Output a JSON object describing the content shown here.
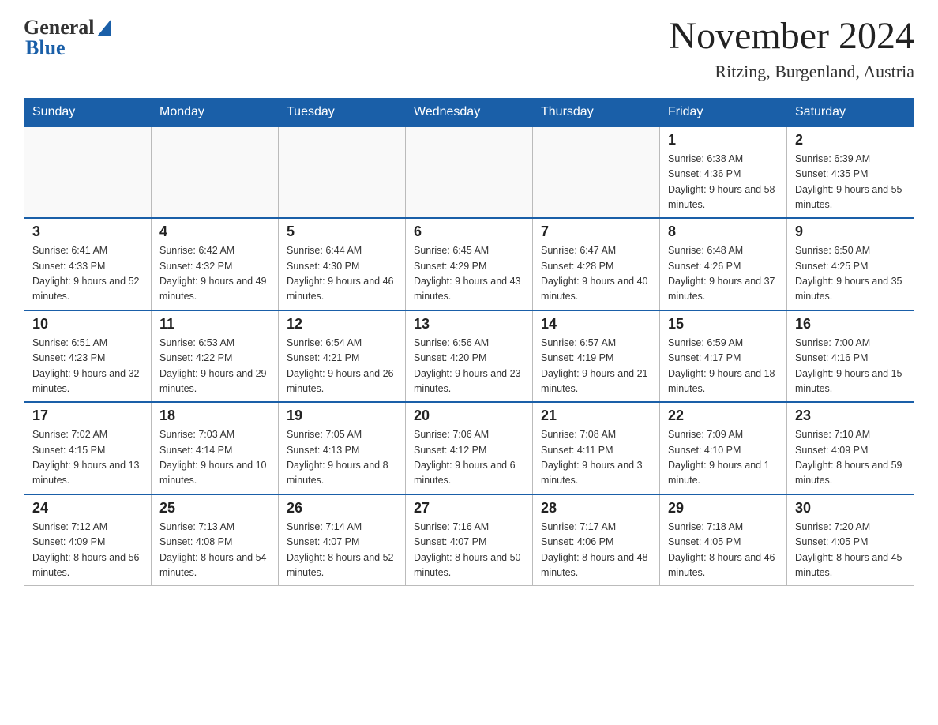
{
  "header": {
    "logo_general": "General",
    "logo_blue": "Blue",
    "title": "November 2024",
    "subtitle": "Ritzing, Burgenland, Austria"
  },
  "days_of_week": [
    "Sunday",
    "Monday",
    "Tuesday",
    "Wednesday",
    "Thursday",
    "Friday",
    "Saturday"
  ],
  "weeks": [
    [
      {
        "day": "",
        "info": ""
      },
      {
        "day": "",
        "info": ""
      },
      {
        "day": "",
        "info": ""
      },
      {
        "day": "",
        "info": ""
      },
      {
        "day": "",
        "info": ""
      },
      {
        "day": "1",
        "info": "Sunrise: 6:38 AM\nSunset: 4:36 PM\nDaylight: 9 hours and 58 minutes."
      },
      {
        "day": "2",
        "info": "Sunrise: 6:39 AM\nSunset: 4:35 PM\nDaylight: 9 hours and 55 minutes."
      }
    ],
    [
      {
        "day": "3",
        "info": "Sunrise: 6:41 AM\nSunset: 4:33 PM\nDaylight: 9 hours and 52 minutes."
      },
      {
        "day": "4",
        "info": "Sunrise: 6:42 AM\nSunset: 4:32 PM\nDaylight: 9 hours and 49 minutes."
      },
      {
        "day": "5",
        "info": "Sunrise: 6:44 AM\nSunset: 4:30 PM\nDaylight: 9 hours and 46 minutes."
      },
      {
        "day": "6",
        "info": "Sunrise: 6:45 AM\nSunset: 4:29 PM\nDaylight: 9 hours and 43 minutes."
      },
      {
        "day": "7",
        "info": "Sunrise: 6:47 AM\nSunset: 4:28 PM\nDaylight: 9 hours and 40 minutes."
      },
      {
        "day": "8",
        "info": "Sunrise: 6:48 AM\nSunset: 4:26 PM\nDaylight: 9 hours and 37 minutes."
      },
      {
        "day": "9",
        "info": "Sunrise: 6:50 AM\nSunset: 4:25 PM\nDaylight: 9 hours and 35 minutes."
      }
    ],
    [
      {
        "day": "10",
        "info": "Sunrise: 6:51 AM\nSunset: 4:23 PM\nDaylight: 9 hours and 32 minutes."
      },
      {
        "day": "11",
        "info": "Sunrise: 6:53 AM\nSunset: 4:22 PM\nDaylight: 9 hours and 29 minutes."
      },
      {
        "day": "12",
        "info": "Sunrise: 6:54 AM\nSunset: 4:21 PM\nDaylight: 9 hours and 26 minutes."
      },
      {
        "day": "13",
        "info": "Sunrise: 6:56 AM\nSunset: 4:20 PM\nDaylight: 9 hours and 23 minutes."
      },
      {
        "day": "14",
        "info": "Sunrise: 6:57 AM\nSunset: 4:19 PM\nDaylight: 9 hours and 21 minutes."
      },
      {
        "day": "15",
        "info": "Sunrise: 6:59 AM\nSunset: 4:17 PM\nDaylight: 9 hours and 18 minutes."
      },
      {
        "day": "16",
        "info": "Sunrise: 7:00 AM\nSunset: 4:16 PM\nDaylight: 9 hours and 15 minutes."
      }
    ],
    [
      {
        "day": "17",
        "info": "Sunrise: 7:02 AM\nSunset: 4:15 PM\nDaylight: 9 hours and 13 minutes."
      },
      {
        "day": "18",
        "info": "Sunrise: 7:03 AM\nSunset: 4:14 PM\nDaylight: 9 hours and 10 minutes."
      },
      {
        "day": "19",
        "info": "Sunrise: 7:05 AM\nSunset: 4:13 PM\nDaylight: 9 hours and 8 minutes."
      },
      {
        "day": "20",
        "info": "Sunrise: 7:06 AM\nSunset: 4:12 PM\nDaylight: 9 hours and 6 minutes."
      },
      {
        "day": "21",
        "info": "Sunrise: 7:08 AM\nSunset: 4:11 PM\nDaylight: 9 hours and 3 minutes."
      },
      {
        "day": "22",
        "info": "Sunrise: 7:09 AM\nSunset: 4:10 PM\nDaylight: 9 hours and 1 minute."
      },
      {
        "day": "23",
        "info": "Sunrise: 7:10 AM\nSunset: 4:09 PM\nDaylight: 8 hours and 59 minutes."
      }
    ],
    [
      {
        "day": "24",
        "info": "Sunrise: 7:12 AM\nSunset: 4:09 PM\nDaylight: 8 hours and 56 minutes."
      },
      {
        "day": "25",
        "info": "Sunrise: 7:13 AM\nSunset: 4:08 PM\nDaylight: 8 hours and 54 minutes."
      },
      {
        "day": "26",
        "info": "Sunrise: 7:14 AM\nSunset: 4:07 PM\nDaylight: 8 hours and 52 minutes."
      },
      {
        "day": "27",
        "info": "Sunrise: 7:16 AM\nSunset: 4:07 PM\nDaylight: 8 hours and 50 minutes."
      },
      {
        "day": "28",
        "info": "Sunrise: 7:17 AM\nSunset: 4:06 PM\nDaylight: 8 hours and 48 minutes."
      },
      {
        "day": "29",
        "info": "Sunrise: 7:18 AM\nSunset: 4:05 PM\nDaylight: 8 hours and 46 minutes."
      },
      {
        "day": "30",
        "info": "Sunrise: 7:20 AM\nSunset: 4:05 PM\nDaylight: 8 hours and 45 minutes."
      }
    ]
  ]
}
